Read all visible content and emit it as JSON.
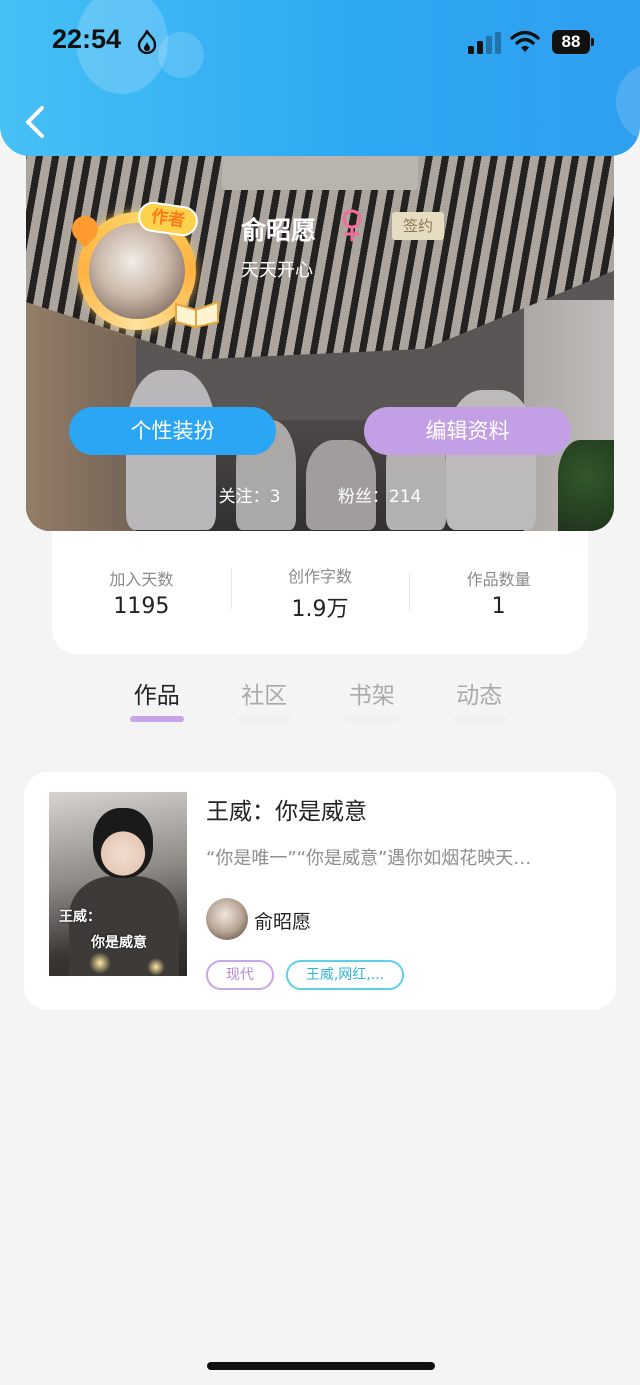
{
  "status_bar": {
    "time": "22:54",
    "battery": "88"
  },
  "profile": {
    "author_badge": "作者",
    "name": "俞昭愿",
    "signed_label": "签约",
    "bio": "天天开心",
    "decorate_button": "个性装扮",
    "edit_button": "编辑资料",
    "following": "关注：3",
    "followers": "粉丝：214"
  },
  "stats": [
    {
      "label": "加入天数",
      "value": "1195"
    },
    {
      "label": "创作字数",
      "value": "1.9万"
    },
    {
      "label": "作品数量",
      "value": "1"
    }
  ],
  "tabs": [
    {
      "label": "作品",
      "active": true
    },
    {
      "label": "社区",
      "active": false
    },
    {
      "label": "书架",
      "active": false
    },
    {
      "label": "动态",
      "active": false
    }
  ],
  "works": [
    {
      "title": "王威：你是威意",
      "description": "“你是唯一”“你是威意”遇你如烟花映天…",
      "author": "俞昭愿",
      "cover_text_line1": "王威：",
      "cover_text_line2": "你是威意",
      "tags": [
        "现代",
        "王威,网红,..."
      ]
    }
  ],
  "colors": {
    "header": "#2ea8f2",
    "decorate_button": "#2aa6f5",
    "edit_button": "#c3a0e6",
    "active_tab_underline": "#c7a3e8"
  }
}
